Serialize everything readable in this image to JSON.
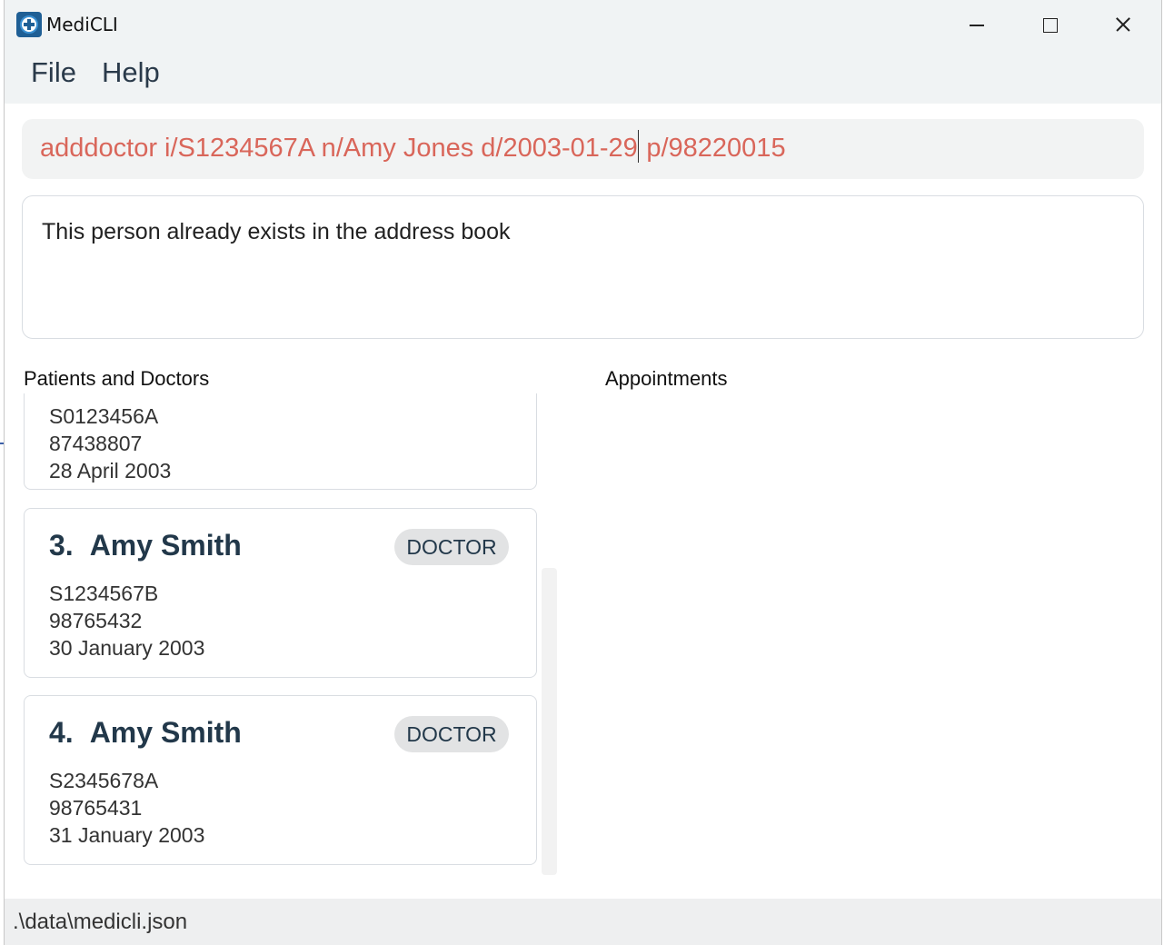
{
  "window": {
    "title": "MediCLI"
  },
  "menu": {
    "file": "File",
    "help": "Help"
  },
  "command": {
    "before_caret": "adddoctor i/S1234567A n/Amy Jones d/2003-01-29",
    "after_caret": " p/98220015"
  },
  "result": {
    "message": "This person already exists in the address book"
  },
  "panels": {
    "persons_title": "Patients and Doctors",
    "appointments_title": "Appointments"
  },
  "persons": [
    {
      "nric": "S0123456A",
      "phone": "87438807",
      "dob": "28 April 2003"
    },
    {
      "index": "3.",
      "name": "Amy Smith",
      "role": "DOCTOR",
      "nric": "S1234567B",
      "phone": "98765432",
      "dob": "30 January 2003"
    },
    {
      "index": "4.",
      "name": "Amy Smith",
      "role": "DOCTOR",
      "nric": "S2345678A",
      "phone": "98765431",
      "dob": "31 January 2003"
    }
  ],
  "status": {
    "path": ".\\data\\medicli.json"
  },
  "colors": {
    "command_text": "#d9665a",
    "name_text": "#22384a",
    "badge_bg": "#e2e3e4"
  },
  "icons": {
    "app": "medical-cross-icon",
    "minimize": "minimize-icon",
    "maximize": "maximize-icon",
    "close": "close-icon"
  }
}
